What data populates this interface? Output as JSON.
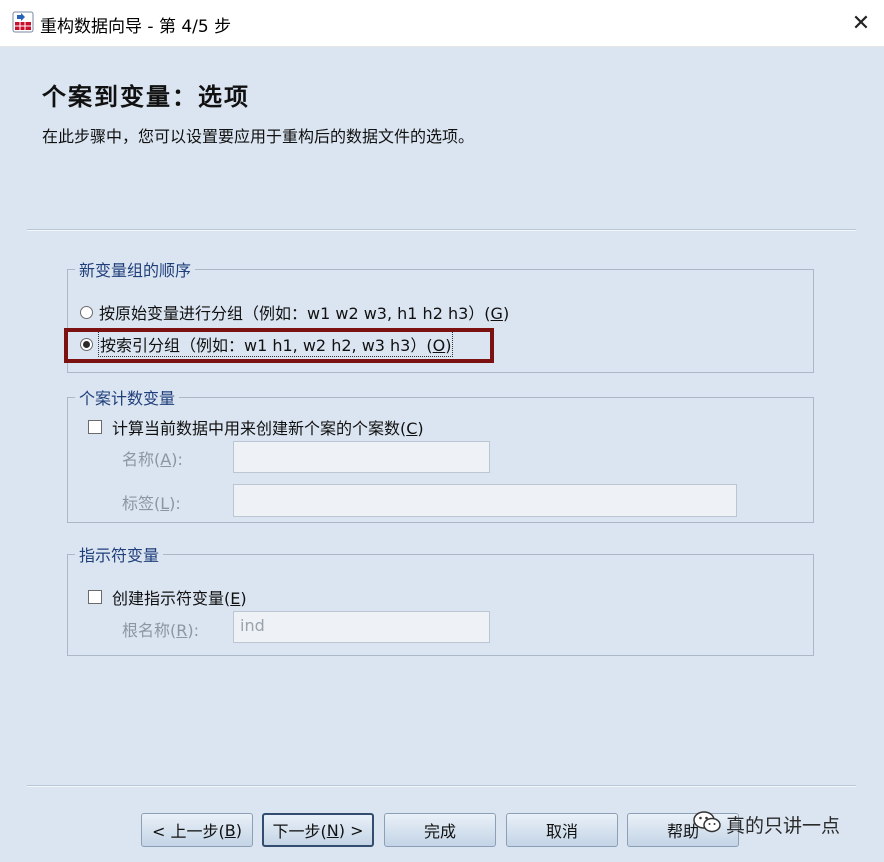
{
  "window": {
    "title": "重构数据向导 - 第 4/5 步",
    "close_glyph": "✕",
    "icon": "spss-wizard-icon"
  },
  "page": {
    "heading": "个案到变量：选项",
    "description": "在此步骤中，您可以设置要应用于重构后的数据文件的选项。"
  },
  "order_group": {
    "title": "新变量组的顺序",
    "options": [
      {
        "label": "按原始变量进行分组（例如：w1 w2 w3, h1 h2 h3）(",
        "key": "G",
        "suffix": ")",
        "selected": false
      },
      {
        "label": "按索引分组（例如：w1 h1, w2 h2, w3 h3）(",
        "key": "O",
        "suffix": ")",
        "selected": true
      }
    ]
  },
  "count_group": {
    "title": "个案计数变量",
    "checkbox": {
      "label": "计算当前数据中用来创建新个案的个案数(",
      "key": "C",
      "suffix": ")",
      "checked": false
    },
    "name_label": {
      "prefix": "名称(",
      "key": "A",
      "suffix": "):"
    },
    "name_value": "",
    "tag_label": {
      "prefix": "标签(",
      "key": "L",
      "suffix": "):"
    },
    "tag_value": ""
  },
  "indicator_group": {
    "title": "指示符变量",
    "checkbox": {
      "label": "创建指示符变量(",
      "key": "E",
      "suffix": ")",
      "checked": false
    },
    "root_label": {
      "prefix": "根名称(",
      "key": "R",
      "suffix": "):"
    },
    "root_value": "ind"
  },
  "buttons": {
    "back": {
      "prefix": "< 上一步(",
      "key": "B",
      "suffix": ")"
    },
    "next": {
      "prefix": "下一步(",
      "key": "N",
      "suffix": ") >"
    },
    "finish": "完成",
    "cancel": "取消",
    "help": "帮助"
  },
  "watermark": {
    "text": "真的只讲一点",
    "icon": "wechat-icon"
  },
  "colors": {
    "highlight_border": "#7b1111",
    "group_title": "#1f3f7a",
    "background": "#dbe5f1"
  }
}
